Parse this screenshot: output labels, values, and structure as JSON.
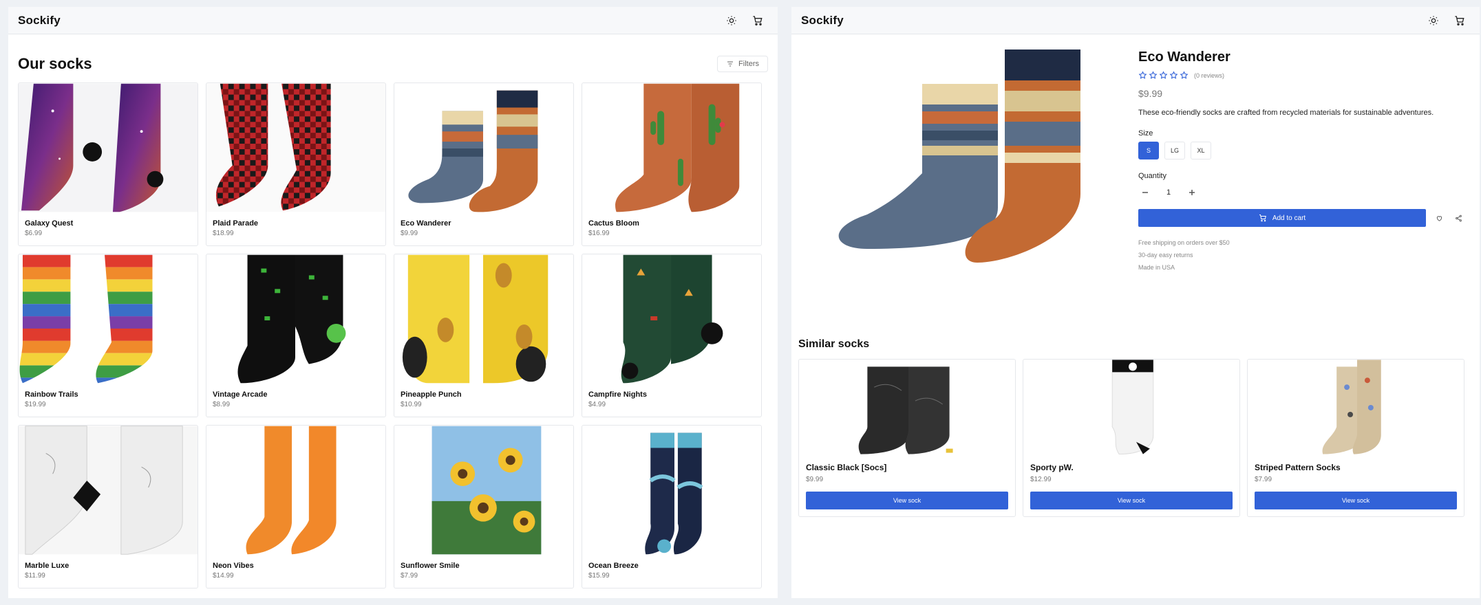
{
  "left": {
    "brand": "Sockify",
    "title": "Our socks",
    "filters_label": "Filters",
    "products": [
      {
        "name": "Galaxy Quest",
        "price": "$6.99"
      },
      {
        "name": "Plaid Parade",
        "price": "$18.99"
      },
      {
        "name": "Eco Wanderer",
        "price": "$9.99"
      },
      {
        "name": "Cactus Bloom",
        "price": "$16.99"
      },
      {
        "name": "Rainbow Trails",
        "price": "$19.99"
      },
      {
        "name": "Vintage Arcade",
        "price": "$8.99"
      },
      {
        "name": "Pineapple Punch",
        "price": "$10.99"
      },
      {
        "name": "Campfire Nights",
        "price": "$4.99"
      },
      {
        "name": "Marble Luxe",
        "price": "$11.99"
      },
      {
        "name": "Neon Vibes",
        "price": "$14.99"
      },
      {
        "name": "Sunflower Smile",
        "price": "$7.99"
      },
      {
        "name": "Ocean Breeze",
        "price": "$15.99"
      }
    ]
  },
  "right": {
    "brand": "Sockify",
    "product": {
      "name": "Eco Wanderer",
      "reviews": "(0 reviews)",
      "rating": 0,
      "price": "$9.99",
      "description": "These eco-friendly socks are crafted from recycled materials for sustainable adventures.",
      "size_label": "Size",
      "sizes": [
        "S",
        "LG",
        "XL"
      ],
      "selected_size": "S",
      "quantity_label": "Quantity",
      "quantity": "1",
      "add_to_cart": "Add to cart",
      "perks": [
        "Free shipping on orders over $50",
        "30-day easy returns",
        "Made in USA"
      ]
    },
    "similar_title": "Similar socks",
    "similar": [
      {
        "name": "Classic Black [Socs]",
        "price": "$9.99",
        "button": "View sock"
      },
      {
        "name": "Sporty pW.",
        "price": "$12.99",
        "button": "View sock"
      },
      {
        "name": "Striped Pattern Socks",
        "price": "$7.99",
        "button": "View sock"
      }
    ]
  },
  "colors": {
    "accent": "#3262d8",
    "muted_text": "#777777",
    "border": "#e5e7eb",
    "background": "#eef1f5"
  },
  "icons": {
    "theme": "sun-icon",
    "cart": "cart-icon",
    "filters": "filter-icon",
    "wishlist": "heart-icon",
    "share": "share-icon",
    "rating": "star-icon"
  }
}
